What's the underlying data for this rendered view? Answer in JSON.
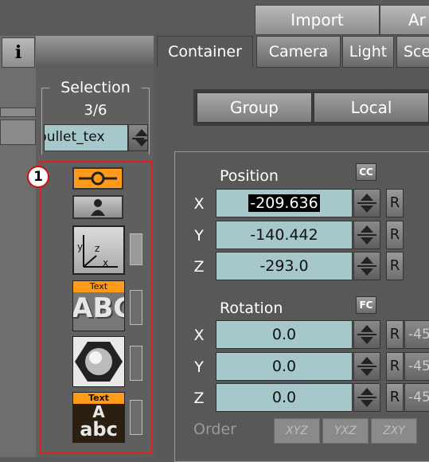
{
  "topbar": {
    "import_label": "Import",
    "next_label": "Ar"
  },
  "info_label": "i",
  "tabs": [
    {
      "label": "Container"
    },
    {
      "label": "Camera"
    },
    {
      "label": "Light"
    },
    {
      "label": "Sce"
    }
  ],
  "selection": {
    "title": "Selection",
    "count": "3/6",
    "value": "bullet_tex"
  },
  "badge": "1",
  "icons": {
    "text_tag_1": "Text",
    "abc_1": "ABC",
    "text_tag_2": "Text",
    "a_2": "A",
    "abc_2": "abc",
    "axis_y": "y",
    "axis_z": "z",
    "axis_x": "x"
  },
  "toggle_left": "Group",
  "toggle_right": "Local",
  "position": {
    "title": "Position",
    "corner_button": "CC",
    "rows": [
      {
        "axis": "X",
        "value": "-209.636",
        "reset": "R"
      },
      {
        "axis": "Y",
        "value": "-140.442",
        "reset": "R"
      },
      {
        "axis": "Z",
        "value": "-293.0",
        "reset": "R"
      }
    ]
  },
  "rotation": {
    "title": "Rotation",
    "corner_button": "FC",
    "rows": [
      {
        "axis": "X",
        "value": "0.0",
        "reset": "R",
        "extra": "-45"
      },
      {
        "axis": "Y",
        "value": "0.0",
        "reset": "R",
        "extra": "-45"
      },
      {
        "axis": "Z",
        "value": "0.0",
        "reset": "R",
        "extra": "-45"
      }
    ]
  },
  "order": {
    "label": "Order",
    "options": [
      "XYZ",
      "YXZ",
      "ZXY"
    ]
  }
}
